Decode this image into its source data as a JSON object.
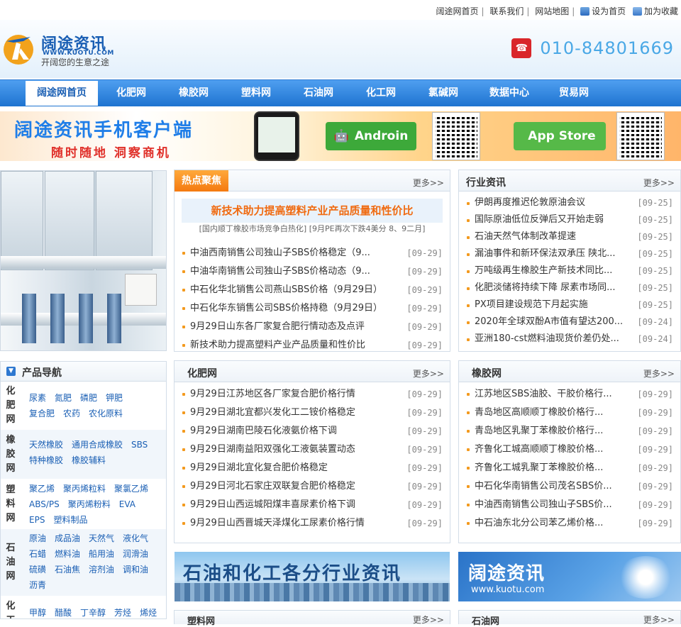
{
  "topbar": {
    "links": [
      "阔途网首页",
      "联系我们",
      "网站地图"
    ],
    "set_home": "设为首页",
    "add_fav": "加为收藏"
  },
  "header": {
    "logo_cn": "阔途资讯",
    "logo_en": "WWW.KUOTU.COM",
    "slogan": "开阔您的生意之途",
    "phone": "010-84801669"
  },
  "nav": {
    "items": [
      "阔途网首页",
      "化肥网",
      "橡胶网",
      "塑料网",
      "石油网",
      "化工网",
      "氯碱网",
      "数据中心",
      "贸易网"
    ],
    "active": 0
  },
  "banner": {
    "title": "阔途资讯手机客户端",
    "subtitle": "随时随地  洞察商机",
    "android": "Androin",
    "appstore": "App Store"
  },
  "hot": {
    "title": "热点聚焦",
    "more": "更多>>",
    "headline": "新技术助力提高塑料产业产品质量和性价比",
    "subline": "[国内顺丁橡胶市场竞争白热化] [9月PE再次下跌4美分 8、9二月]",
    "items": [
      {
        "t": "中油西南销售公司独山子SBS价格稳定（9...",
        "d": "[09-29]"
      },
      {
        "t": "中油华南销售公司独山子SBS价格动态（9...",
        "d": "[09-29]"
      },
      {
        "t": "中石化华北销售公司燕山SBS价格（9月29日）",
        "d": "[09-29]"
      },
      {
        "t": "中石化华东销售公司SBS价格持稳（9月29日）",
        "d": "[09-29]"
      },
      {
        "t": "9月29日山东各厂家复合肥行情动态及点评",
        "d": "[09-29]"
      },
      {
        "t": "新技术助力提高塑料产业产品质量和性价比",
        "d": "[09-29]"
      }
    ]
  },
  "industry": {
    "title": "行业资讯",
    "more": "更多>>",
    "items": [
      {
        "t": "伊朗再度推迟伦敦原油会议",
        "d": "[09-25]"
      },
      {
        "t": "国际原油低位反弹后又开始走弱",
        "d": "[09-25]"
      },
      {
        "t": "石油天然气体制改革提速",
        "d": "[09-25]"
      },
      {
        "t": "漏油事件和新环保法双承压 陕北...",
        "d": "[09-25]"
      },
      {
        "t": "万吨级再生橡胶生产新技术同比...",
        "d": "[09-25]"
      },
      {
        "t": "化肥淡储将持续下降 尿素市场同...",
        "d": "[09-25]"
      },
      {
        "t": "PX项目建设规范下月起实施",
        "d": "[09-25]"
      },
      {
        "t": "2020年全球双酚A市值有望达200...",
        "d": "[09-24]"
      },
      {
        "t": "亚洲180-cst燃料油现货价差仍处...",
        "d": "[09-24]"
      }
    ]
  },
  "fertilizer": {
    "title": "化肥网",
    "more": "更多>>",
    "items": [
      {
        "t": "9月29日江苏地区各厂家复合肥价格行情",
        "d": "[09-29]"
      },
      {
        "t": "9月29日湖北宜都兴发化工二铵价格稳定",
        "d": "[09-29]"
      },
      {
        "t": "9月29日湖南巴陵石化液氨价格下调",
        "d": "[09-29]"
      },
      {
        "t": "9月29日湖南益阳双强化工液氨装置动态",
        "d": "[09-29]"
      },
      {
        "t": "9月29日湖北宜化复合肥价格稳定",
        "d": "[09-29]"
      },
      {
        "t": "9月29日河北石家庄双联复合肥价格稳定",
        "d": "[09-29]"
      },
      {
        "t": "9月29日山西运城阳煤丰喜尿素价格下调",
        "d": "[09-29]"
      },
      {
        "t": "9月29日山西晋城天泽煤化工尿素价格行情",
        "d": "[09-29]"
      }
    ]
  },
  "rubber": {
    "title": "橡胶网",
    "more": "更多>>",
    "items": [
      {
        "t": "江苏地区SBS油胶、干胶价格行...",
        "d": "[09-29]"
      },
      {
        "t": "青岛地区高顺顺丁橡胶价格行...",
        "d": "[09-29]"
      },
      {
        "t": "青岛地区乳聚丁苯橡胶价格行...",
        "d": "[09-29]"
      },
      {
        "t": "齐鲁化工城高顺顺丁橡胶价格...",
        "d": "[09-29]"
      },
      {
        "t": "齐鲁化工城乳聚丁苯橡胶价格...",
        "d": "[09-29]"
      },
      {
        "t": "中石化华南销售公司茂名SBS价...",
        "d": "[09-29]"
      },
      {
        "t": "中油西南销售公司独山子SBS价...",
        "d": "[09-29]"
      },
      {
        "t": "中石油东北分公司苯乙烯价格...",
        "d": "[09-29]"
      }
    ]
  },
  "product_nav": {
    "title": "产品导航",
    "groups": [
      {
        "label": [
          "化",
          "肥",
          "网"
        ],
        "items": [
          "尿素",
          "氮肥",
          "磷肥",
          "钾肥",
          "复合肥",
          "农药",
          "农化原料"
        ]
      },
      {
        "label": [
          "橡",
          "胶",
          "网"
        ],
        "items": [
          "天然橡胶",
          "通用合成橡胶",
          "SBS",
          "特种橡胶",
          "橡胶辅料"
        ]
      },
      {
        "label": [
          "塑",
          "料",
          "网"
        ],
        "items": [
          "聚乙烯",
          "聚丙烯粒料",
          "聚氯乙烯",
          "ABS/PS",
          "聚丙烯粉料",
          "EVA",
          "EPS",
          "塑料制品"
        ]
      },
      {
        "label": [
          "石",
          "油",
          "网"
        ],
        "items": [
          "原油",
          "成品油",
          "天然气",
          "液化气",
          "石蜡",
          "燃料油",
          "船用油",
          "润滑油",
          "硫磺",
          "石油焦",
          "溶剂油",
          "调和油",
          "沥青"
        ]
      },
      {
        "label": [
          "化",
          "工"
        ],
        "items": [
          "甲醇",
          "醋酸",
          "丁辛醇",
          "芳烃",
          "烯烃"
        ]
      }
    ]
  },
  "ads": {
    "a1": "石油和化工各分行业资讯",
    "a2_title": "阔途资讯",
    "a2_url": "www.kuotu.com"
  },
  "bottom_heads": [
    {
      "title": "塑料网",
      "more": "更多>>"
    },
    {
      "title": "石油网",
      "more": "更多>>"
    }
  ]
}
